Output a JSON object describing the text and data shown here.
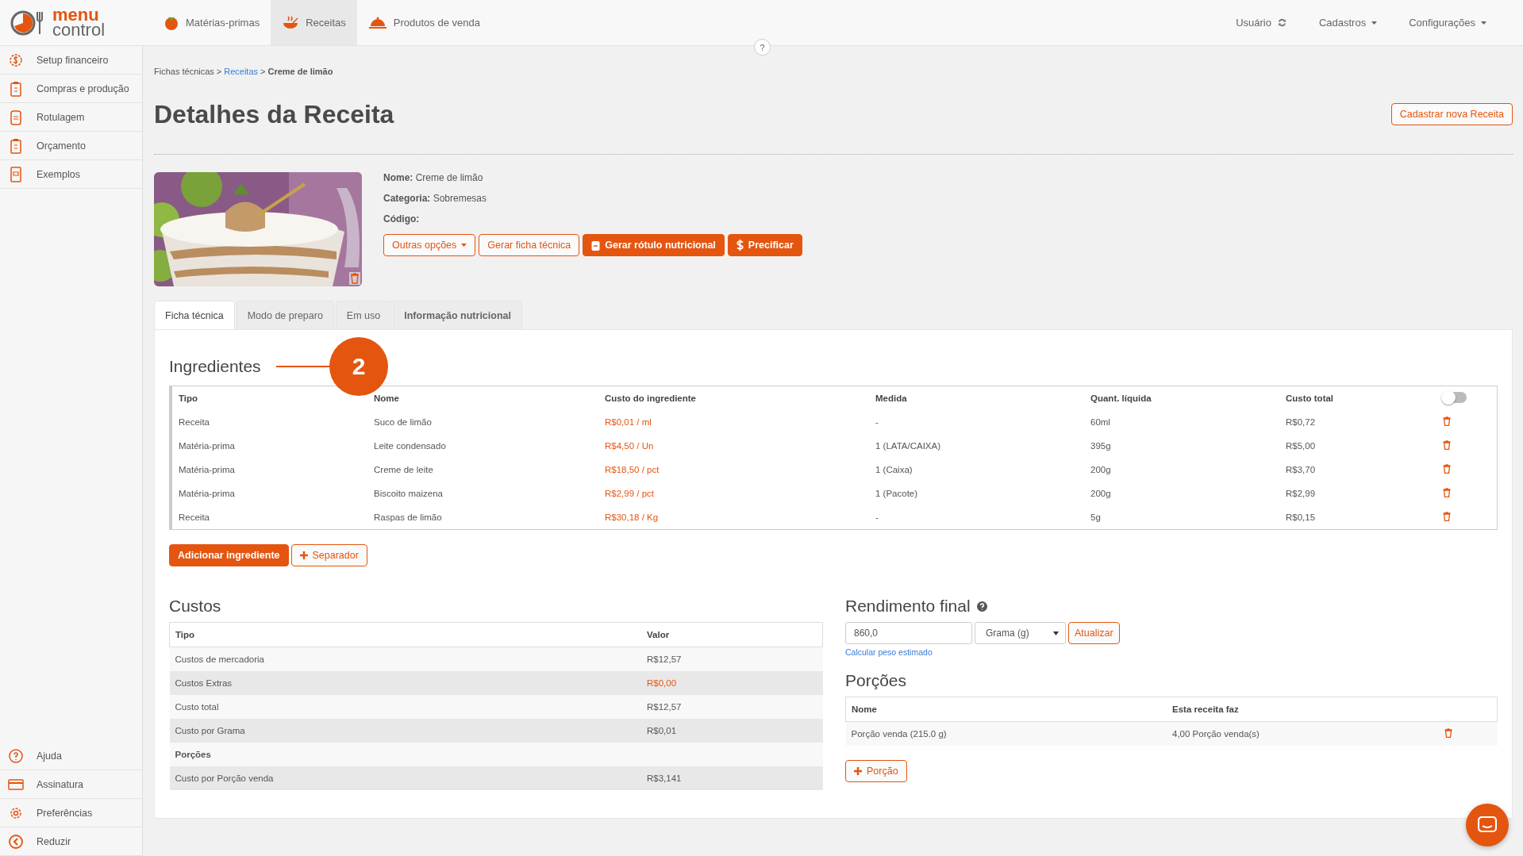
{
  "logo": {
    "line_1": "menu",
    "line_2": "control"
  },
  "top_nav": [
    {
      "label": "Matérias-primas",
      "selected": false
    },
    {
      "label": "Receitas",
      "selected": true
    },
    {
      "label": "Produtos de venda",
      "selected": false
    }
  ],
  "user_menu": [
    {
      "label": "Usuário",
      "kind": "refresh"
    },
    {
      "label": "Cadastros",
      "kind": "dropdown"
    },
    {
      "label": "Configurações",
      "kind": "dropdown"
    }
  ],
  "help_button": "?",
  "sidebar": {
    "items": [
      {
        "label": "Setup financeiro"
      },
      {
        "label": "Compras e produção"
      },
      {
        "label": "Rotulagem"
      },
      {
        "label": "Orçamento"
      },
      {
        "label": "Exemplos"
      }
    ],
    "bottom_items": [
      {
        "label": "Ajuda"
      },
      {
        "label": "Assinatura"
      },
      {
        "label": "Preferências"
      },
      {
        "label": "Reduzir"
      }
    ]
  },
  "breadcrumb": [
    {
      "label": "Fichas técnicas",
      "kind": "text",
      "separator": ">"
    },
    {
      "label": "Receitas",
      "kind": "link",
      "separator": ">"
    },
    {
      "label": "Creme de limão",
      "kind": "current"
    }
  ],
  "title": "Detalhes da Receita",
  "new_button": "Cadastrar nova Receita",
  "details": [
    {
      "label": "Nome:",
      "value": "Creme de limão"
    },
    {
      "label": "Categoria:",
      "value": "Sobremesas"
    },
    {
      "label": "Código:"
    }
  ],
  "actions": [
    {
      "label": "Outras opções",
      "kind": "dropdown"
    },
    {
      "label": "Gerar ficha técnica",
      "kind": "outline"
    },
    {
      "label": "Gerar rótulo nutricional",
      "kind": "label"
    },
    {
      "label": "Precificar",
      "kind": "price"
    }
  ],
  "tabs": [
    {
      "label": "Ficha técnica",
      "selected": true
    },
    {
      "label": "Modo de preparo",
      "selected": false
    },
    {
      "label": "Em uso",
      "selected": false
    },
    {
      "label": "Informação nutricional",
      "selected": false
    }
  ],
  "ingredients": {
    "title": "Ingredientes",
    "annotation": "2",
    "columns": [
      "Tipo",
      "Nome",
      "Custo do ingrediente",
      "Medida",
      "Quant. líquida",
      "Custo total"
    ],
    "toggle_on": false,
    "rows": [
      {
        "tipo": "Receita",
        "nome": "Suco de limão",
        "custo": "R$0,01 / ml",
        "medida": "-",
        "quant": "60ml",
        "total": "R$0,72"
      },
      {
        "tipo": "Matéria-prima",
        "nome": "Leite condensado",
        "custo": "R$4,50 / Un",
        "medida": "1 (LATA/CAIXA)",
        "quant": "395g",
        "total": "R$5,00"
      },
      {
        "tipo": "Matéria-prima",
        "nome": "Creme de leite",
        "custo": "R$18,50 / pct",
        "medida": "1 (Caixa)",
        "quant": "200g",
        "total": "R$3,70"
      },
      {
        "tipo": "Matéria-prima",
        "nome": "Biscoito maizena",
        "custo": "R$2,99 / pct",
        "medida": "1 (Pacote)",
        "quant": "200g",
        "total": "R$2,99"
      },
      {
        "tipo": "Receita",
        "nome": "Raspas de limão",
        "custo": "R$30,18 / Kg",
        "medida": "-",
        "quant": "5g",
        "total": "R$0,15"
      }
    ],
    "add_button": "Adicionar ingrediente",
    "separator_button": "Separador"
  },
  "costs": {
    "title": "Custos",
    "columns": [
      "Tipo",
      "Valor"
    ],
    "rows": [
      {
        "kind": "row",
        "tipo": "Custos de mercadoria",
        "valor": "R$12,57",
        "highlighted": false
      },
      {
        "kind": "row",
        "tipo": "Custos Extras",
        "valor": "R$0,00",
        "highlighted": true
      },
      {
        "kind": "row",
        "tipo": "Custo total",
        "valor": "R$12,57",
        "highlighted": false
      },
      {
        "kind": "row",
        "tipo": "Custo por Grama",
        "valor": "R$0,01",
        "highlighted": false
      },
      {
        "kind": "section",
        "tipo": "Porções"
      },
      {
        "kind": "row",
        "tipo": "Custo por Porção venda",
        "valor": "R$3,141",
        "highlighted": false
      }
    ]
  },
  "yield": {
    "title": "Rendimento final",
    "value": "860,0",
    "unit": "Grama (g)",
    "update_button": "Atualizar",
    "link": "Calcular peso estimado"
  },
  "portions": {
    "title": "Porções",
    "columns": [
      "Nome",
      "Esta receita faz"
    ],
    "rows": [
      {
        "nome": "Porção venda (215.0 g)",
        "faz": "4,00 Porção venda(s)"
      }
    ],
    "add_button": "Porção"
  }
}
